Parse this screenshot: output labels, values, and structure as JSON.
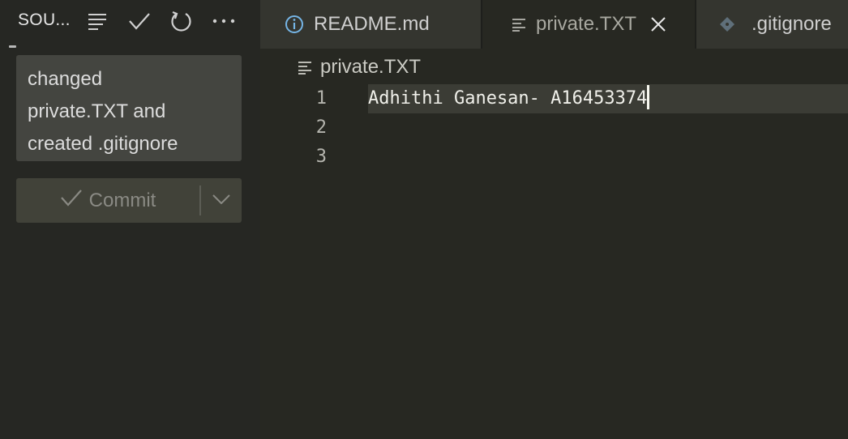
{
  "sidebar": {
    "title": "SOU...",
    "actions": [
      {
        "icon": "view-as-tree-icon"
      },
      {
        "icon": "check-icon"
      },
      {
        "icon": "refresh-icon"
      },
      {
        "icon": "more-icon"
      }
    ],
    "commit_message_lines": [
      "changed",
      "private.TXT and",
      "created .gitignore"
    ],
    "commit_label": "Commit"
  },
  "tabs": [
    {
      "label": "README.md",
      "icon": "info-icon",
      "state": "inactive"
    },
    {
      "label": "private.TXT",
      "icon": "text-file-icon",
      "state": "active"
    },
    {
      "label": ".gitignore",
      "icon": "git-icon",
      "state": "inactive"
    }
  ],
  "breadcrumb": {
    "label": "private.TXT",
    "icon": "text-file-icon"
  },
  "editor": {
    "line_numbers": [
      "1",
      "2",
      "3"
    ],
    "lines": [
      "Adhithi Ganesan- A16453374",
      "",
      ""
    ],
    "cursor_line": 1
  },
  "colors": {
    "background": "#272822",
    "sidebar": "#262723",
    "tab_inactive": "#34352f",
    "accent_info": "#75b5e6"
  }
}
